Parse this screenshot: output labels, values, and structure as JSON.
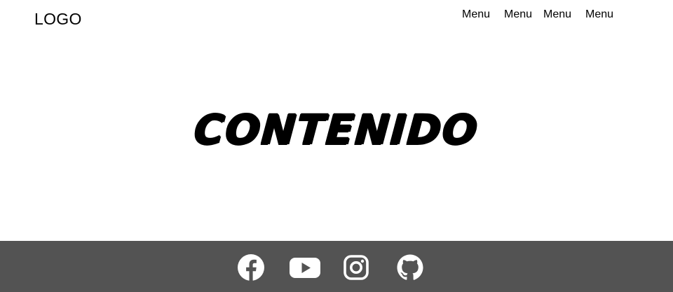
{
  "header": {
    "logo": "LOGO",
    "menu": [
      {
        "label": "Menu"
      },
      {
        "label": "Menu"
      },
      {
        "label": "Menu"
      },
      {
        "label": "Menu"
      }
    ]
  },
  "main": {
    "title": "CONTENIDO"
  },
  "footer": {
    "background": "#535353",
    "icon_color": "#ffffff",
    "social": [
      {
        "icon": "facebook-icon"
      },
      {
        "icon": "youtube-icon"
      },
      {
        "icon": "instagram-icon"
      },
      {
        "icon": "github-icon"
      }
    ]
  }
}
